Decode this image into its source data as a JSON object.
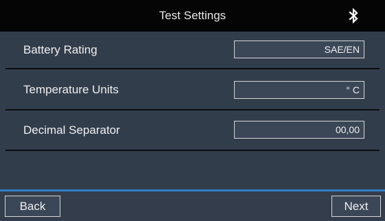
{
  "header": {
    "title": "Test Settings",
    "bluetooth_icon": "bluetooth-icon"
  },
  "settings": [
    {
      "label": "Battery Rating",
      "value": "SAE/EN"
    },
    {
      "label": "Temperature Units",
      "value": "° C"
    },
    {
      "label": "Decimal Separator",
      "value": "00,00"
    }
  ],
  "footer": {
    "back_label": "Back",
    "next_label": "Next"
  },
  "colors": {
    "header_bg": "#050505",
    "panel_bg": "#323d4c",
    "footer_accent": "#2f7fc7",
    "text": "#f0f0f0"
  }
}
